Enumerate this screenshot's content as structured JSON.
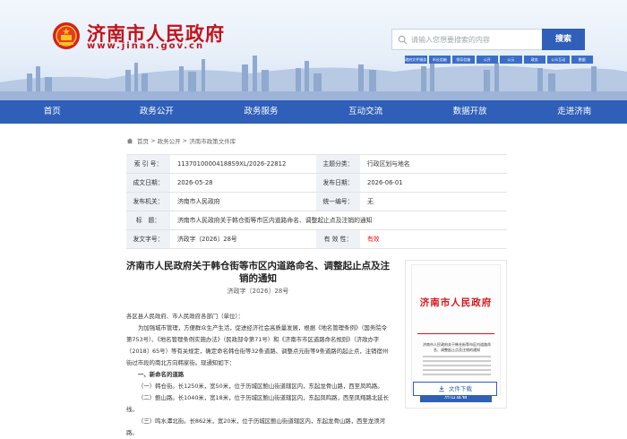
{
  "site": {
    "title": "济南市人民政府",
    "url": "www.jinan.gov.cn"
  },
  "search": {
    "placeholder": "请输入您想要搜索的内容",
    "button": "搜索"
  },
  "quick_links": [
    "政府文件服务",
    "市长信箱",
    "领导信箱",
    "公开",
    "公示",
    "政务",
    "公众互动",
    "数据"
  ],
  "nav": [
    "首页",
    "政务公开",
    "政务服务",
    "互动交流",
    "数据开放",
    "走进济南"
  ],
  "breadcrumb": [
    "首页",
    "政务公开",
    "济南市政策文件库"
  ],
  "meta": {
    "index_label": "索 引 号：",
    "index_value": "11370100004188S9XL/2026-22812",
    "topic_label": "主题分类：",
    "topic_value": "行政区划与地名",
    "created_label": "成文日期：",
    "created_value": "2026-05-28",
    "published_label": "发布日期：",
    "published_value": "2026-06-01",
    "issuer_label": "发布机关：",
    "issuer_value": "济南市人民政府",
    "uniform_label": "统一编号：",
    "uniform_value": "无",
    "title_label": "标　题：",
    "title_value": "济南市人民政府关于韩仓街等市区内道路命名、调整起止点及注销的通知",
    "docno_label": "发文字号：",
    "docno_value": "济政字〔2026〕28号",
    "validity_label": "有 效 性：",
    "validity_value": "有效"
  },
  "document": {
    "title": "济南市人民政府关于韩仓街等市区内道路命名、调整起止点及注销的通知",
    "number": "济政字〔2026〕28号",
    "salutation": "各区县人民政府、市人民政府各部门（单位）：",
    "intro": "为加强城市管理，方便群众生产生活，促进经济社会高质量发展，根据《地名管理条例》（国务院令第753号）、《地名管理条例实施办法》（民政部令第71号）和《济南市市区道路命名规则》（济政办字〔2018〕65号）等有关规定，确定命名韩仓街等32条道路、调整点元街等9条道路的起止点，注销宿州街过市段的南北方向韩家街。现通知如下：",
    "section1": "一、新命名的道路",
    "item1": "（一）韩仓街。长1250米，宽50米，位于历城区鲍山街道辖区内，东起龙骨山路，西至凤鸣路。",
    "item2": "（二）鲍山路。长1040米，宽18米，位于历城区鲍山街道辖区内，东起凤鸣路，西至凤翔路北延长线。",
    "item3": "（三）鸣水潭北街。长862米，宽20米，位于历城区鲍山街道辖区内，东起龙骨山路，西至龙须河路。"
  },
  "thumbnail": {
    "header": "济南市人民政府",
    "doc_caption": "济南市人民政府关于韩仓街等市区内道路命名、调整起止点及注销的通知",
    "preview_button": "点击查看"
  },
  "download": {
    "label": "文件下载"
  },
  "colors": {
    "brand_red": "#c4121a",
    "nav_blue": "#2f5fb9",
    "label_bg": "#eef2f7"
  }
}
